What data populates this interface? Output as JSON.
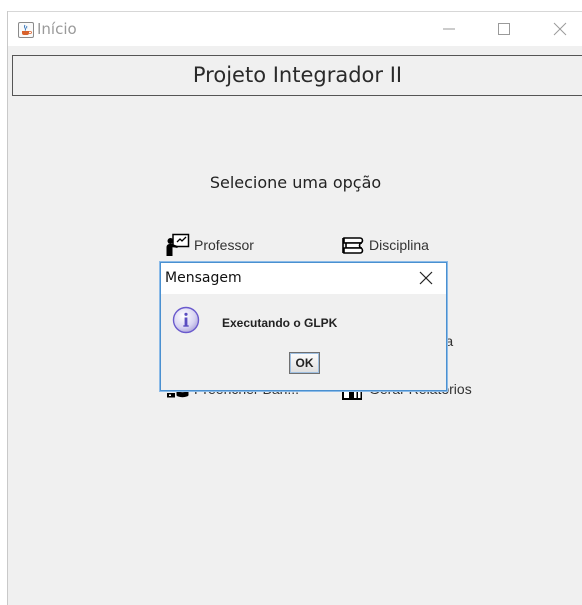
{
  "window": {
    "title": "Início",
    "icon": "java-cup-icon",
    "controls": [
      "minimize-icon",
      "maximize-icon",
      "close-icon"
    ]
  },
  "banner": {
    "title": "Projeto Integrador II"
  },
  "main": {
    "subtitle": "Selecione uma opção",
    "buttons": [
      {
        "label": "Professor",
        "icon": "teacher-board-icon"
      },
      {
        "label": "Disciplina",
        "icon": "books-icon"
      },
      {
        "label": "blema",
        "icon": ""
      },
      {
        "label": "Preencher Ban...",
        "icon": "database-icon"
      },
      {
        "label": "Gerar Relatórios",
        "icon": "report-icon"
      }
    ]
  },
  "dialog": {
    "title": "Mensagem",
    "message": "Executando o GLPK",
    "ok_label": "OK",
    "icon": "info-icon"
  },
  "colors": {
    "dialog_border": "#4a90d0",
    "info_icon": "#6a5acd"
  }
}
